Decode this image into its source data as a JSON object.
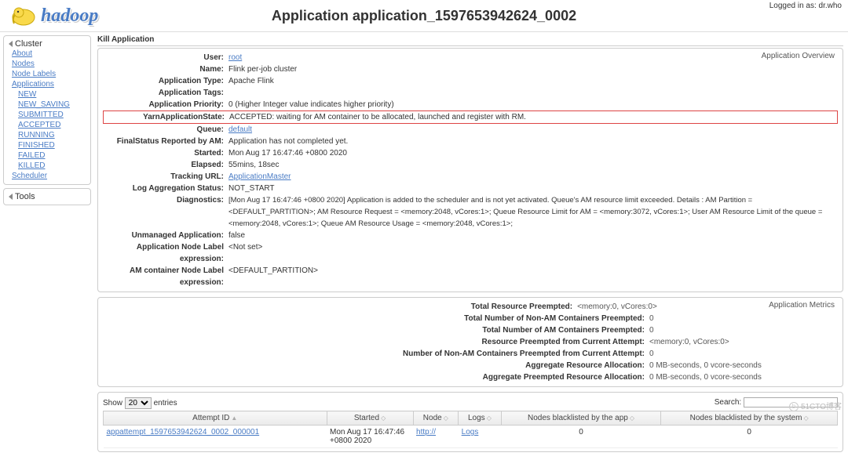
{
  "header": {
    "logo_text": "hadoop",
    "title": "Application application_1597653942624_0002",
    "login": "Logged in as: dr.who"
  },
  "nav": {
    "cluster": {
      "head": "Cluster",
      "items": [
        "About",
        "Nodes",
        "Node Labels",
        "Applications"
      ],
      "app_states": [
        "NEW",
        "NEW_SAVING",
        "SUBMITTED",
        "ACCEPTED",
        "RUNNING",
        "FINISHED",
        "FAILED",
        "KILLED"
      ],
      "scheduler": "Scheduler"
    },
    "tools": "Tools"
  },
  "kill": "Kill Application",
  "overview": {
    "legend": "Application Overview",
    "user": {
      "label": "User:",
      "value": "root"
    },
    "name": {
      "label": "Name:",
      "value": "Flink per-job cluster"
    },
    "type": {
      "label": "Application Type:",
      "value": "Apache Flink"
    },
    "tags": {
      "label": "Application Tags:",
      "value": ""
    },
    "priority": {
      "label": "Application Priority:",
      "value": "0 (Higher Integer value indicates higher priority)"
    },
    "state": {
      "label": "YarnApplicationState:",
      "value": "ACCEPTED: waiting for AM container to be allocated, launched and register with RM."
    },
    "queue": {
      "label": "Queue:",
      "value": "default"
    },
    "final": {
      "label": "FinalStatus Reported by AM:",
      "value": "Application has not completed yet."
    },
    "started": {
      "label": "Started:",
      "value": "Mon Aug 17 16:47:46 +0800 2020"
    },
    "elapsed": {
      "label": "Elapsed:",
      "value": "55mins, 18sec"
    },
    "tracking": {
      "label": "Tracking URL:",
      "value": "ApplicationMaster"
    },
    "logagg": {
      "label": "Log Aggregation Status:",
      "value": "NOT_START"
    },
    "diag": {
      "label": "Diagnostics:",
      "value": "[Mon Aug 17 16:47:46 +0800 2020] Application is added to the scheduler and is not yet activated. Queue's AM resource limit exceeded. Details : AM Partition = <DEFAULT_PARTITION>; AM Resource Request = <memory:2048, vCores:1>; Queue Resource Limit for AM = <memory:3072, vCores:1>; User AM Resource Limit of the queue = <memory:2048, vCores:1>; Queue AM Resource Usage = <memory:2048, vCores:1>; "
    },
    "unmanaged": {
      "label": "Unmanaged Application:",
      "value": "false"
    },
    "nodelabel": {
      "label": "Application Node Label expression:",
      "value": "<Not set>"
    },
    "amlabel": {
      "label": "AM container Node Label expression:",
      "value": "<DEFAULT_PARTITION>"
    }
  },
  "metrics": {
    "legend": "Application Metrics",
    "rows": [
      {
        "label": "Total Resource Preempted:",
        "value": "<memory:0, vCores:0>"
      },
      {
        "label": "Total Number of Non-AM Containers Preempted:",
        "value": "0"
      },
      {
        "label": "Total Number of AM Containers Preempted:",
        "value": "0"
      },
      {
        "label": "Resource Preempted from Current Attempt:",
        "value": "<memory:0, vCores:0>"
      },
      {
        "label": "Number of Non-AM Containers Preempted from Current Attempt:",
        "value": "0"
      },
      {
        "label": "Aggregate Resource Allocation:",
        "value": "0 MB-seconds, 0 vcore-seconds"
      },
      {
        "label": "Aggregate Preempted Resource Allocation:",
        "value": "0 MB-seconds, 0 vcore-seconds"
      }
    ]
  },
  "dt": {
    "show": "Show",
    "entries": "entries",
    "page_size": "20",
    "search_label": "Search:",
    "cols": [
      "Attempt ID",
      "Started",
      "Node",
      "Logs",
      "Nodes blacklisted by the app",
      "Nodes blacklisted by the system"
    ],
    "row": {
      "id": "appattempt_1597653942624_0002_000001",
      "started": "Mon Aug 17 16:47:46 +0800 2020",
      "node": "http://",
      "logs": "Logs",
      "bl_app": "0",
      "bl_sys": "0"
    }
  },
  "watermark": "51CTO博客"
}
